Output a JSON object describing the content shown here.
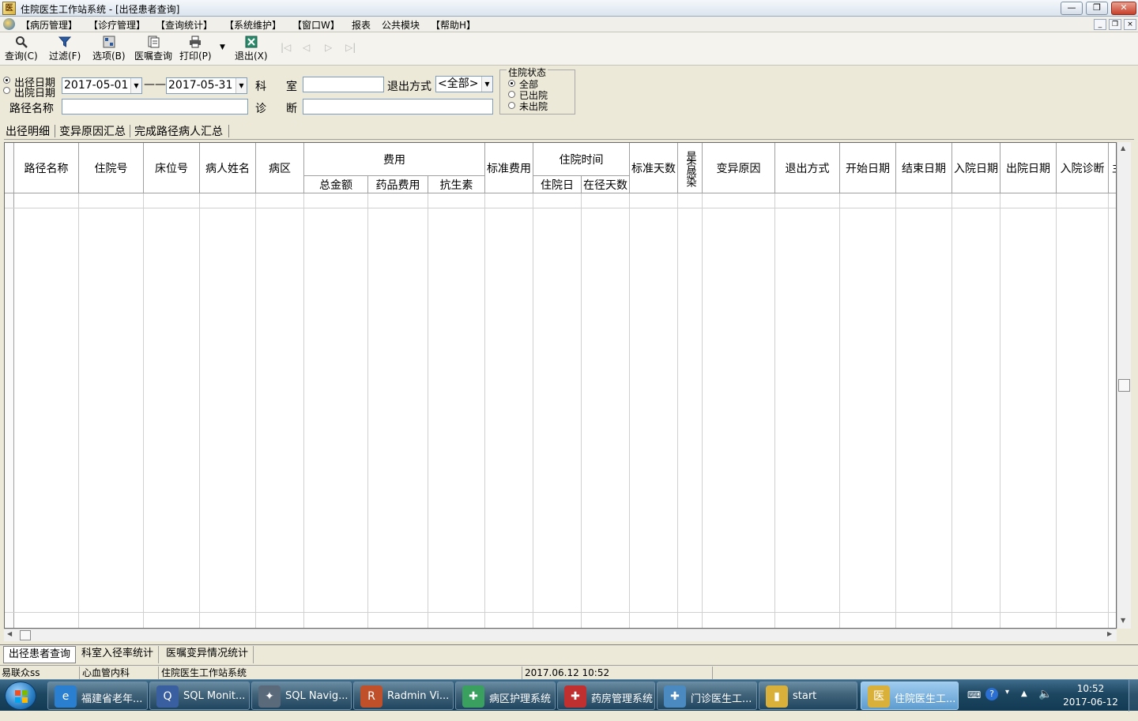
{
  "window": {
    "title": "住院医生工作站系统 - [出径患者查询]",
    "controls": {
      "minimize": "—",
      "restore": "❐",
      "close": "✕"
    },
    "mdi_controls": {
      "minimize": "_",
      "restore": "❐",
      "close": "×"
    }
  },
  "menu": [
    "【病历管理】",
    "【诊疗管理】",
    "【查询统计】",
    "【系统维护】",
    "【窗口W】",
    "报表",
    "公共模块",
    "【帮助H】"
  ],
  "toolbar": {
    "query": {
      "label": "查询(C)",
      "icon": "magnifier-icon"
    },
    "filter": {
      "label": "过滤(F)",
      "icon": "funnel-icon"
    },
    "options": {
      "label": "选项(B)",
      "icon": "options-icon"
    },
    "order_query": {
      "label": "医嘱查询",
      "icon": "document-icon"
    },
    "print": {
      "label": "打印(P)",
      "icon": "printer-icon"
    },
    "print_dropdown": "▼",
    "exit": {
      "label": "退出(X)",
      "icon": "exit-icon"
    },
    "nav": {
      "first": "|◁",
      "prev": "◁",
      "next": "▷",
      "last": "▷|"
    }
  },
  "filters": {
    "date_type_options": [
      {
        "label": "出径日期",
        "checked": true
      },
      {
        "label": "出院日期",
        "checked": false
      }
    ],
    "date_from": "2017-05-01",
    "date_sep": "——",
    "date_to": "2017-05-31",
    "dept_label_1": "科",
    "dept_label_2": "室",
    "dept_value": "",
    "exit_mode_label": "退出方式",
    "exit_mode_value": "<全部>",
    "path_name_label": "路径名称",
    "path_name_value": "",
    "diag_label_1": "诊",
    "diag_label_2": "断",
    "diag_value": "",
    "status_group": {
      "title": "住院状态",
      "options": [
        {
          "label": "全部",
          "checked": true
        },
        {
          "label": "已出院",
          "checked": false
        },
        {
          "label": "未出院",
          "checked": false
        }
      ]
    }
  },
  "tabs": [
    "出径明细",
    "变异原因汇总",
    "完成路径病人汇总"
  ],
  "grid": {
    "headers": {
      "path_name": "路径名称",
      "inpatient_no": "住院号",
      "bed_no": "床位号",
      "patient_name": "病人姓名",
      "ward": "病区",
      "cost": "费用",
      "cost_total": "总金额",
      "cost_drug": "药品费用",
      "cost_antibiotic": "抗生素",
      "std_cost": "标准费用",
      "stay_time": "住院时间",
      "stay_days": "住院日",
      "path_days": "在径天数",
      "std_days": "标准天数",
      "infected": "是否感染",
      "variation_reason": "变异原因",
      "exit_mode": "退出方式",
      "start_date": "开始日期",
      "end_date": "结束日期",
      "admit_date": "入院日期",
      "discharge_date": "出院日期",
      "admit_diag": "入院诊断",
      "more": "主"
    },
    "rows": []
  },
  "bottom_tabs": [
    "出径患者查询",
    "科室入径率统计",
    "医嘱变异情况统计"
  ],
  "status": {
    "user": "易联众ss",
    "dept": "心血管内科",
    "system": "住院医生工作站系统",
    "datetime": "2017.06.12 10:52"
  },
  "taskbar": {
    "items": [
      {
        "label": "福建省老年...",
        "icon": "ie-icon",
        "color": "#2a7fd1"
      },
      {
        "label": "SQL Monit...",
        "icon": "sql-monitor-icon",
        "color": "#3a5fa0"
      },
      {
        "label": "SQL Navig...",
        "icon": "sql-navigator-icon",
        "color": "#5a6a7a"
      },
      {
        "label": "Radmin Vi...",
        "icon": "radmin-icon",
        "color": "#c0502a"
      },
      {
        "label": "病区护理系统",
        "icon": "nursing-system-icon",
        "color": "#3aa060"
      },
      {
        "label": "药房管理系统",
        "icon": "pharmacy-system-icon",
        "color": "#c03030"
      },
      {
        "label": "门诊医生工...",
        "icon": "outpatient-system-icon",
        "color": "#4a8ac0"
      },
      {
        "label": "start",
        "icon": "folder-icon",
        "color": "#d9b13a"
      },
      {
        "label": "住院医生工...",
        "icon": "inpatient-system-icon",
        "color": "#d9b13a"
      }
    ],
    "clock_time": "10:52",
    "clock_date": "2017-06-12"
  }
}
